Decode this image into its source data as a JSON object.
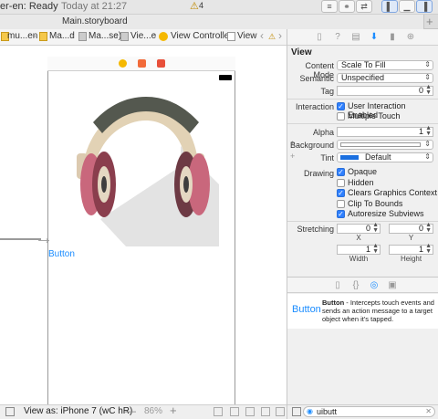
{
  "titlebar": {
    "status_prefix": "er-en:",
    "status_state": "Ready",
    "time": "Today at 21:27",
    "warning_count": "4"
  },
  "tab": {
    "title": "Main.storyboard"
  },
  "jumpbar": {
    "crumbs": [
      "mu...en",
      "Ma...d",
      "Ma...se)",
      "Vie...e",
      "View Controller",
      "View"
    ]
  },
  "canvas": {
    "button_label": "Button"
  },
  "bottombar": {
    "view_as": "View as: iPhone 7 (wC hR)",
    "zoom": "86%",
    "minus": "—",
    "plus": "+"
  },
  "inspector": {
    "section": "View",
    "content_mode_label": "Content Mode",
    "content_mode_value": "Scale To Fill",
    "semantic_label": "Semantic",
    "semantic_value": "Unspecified",
    "tag_label": "Tag",
    "tag_value": "0",
    "interaction_label": "Interaction",
    "user_interaction": "User Interaction Enabled",
    "multiple_touch": "Multiple Touch",
    "alpha_label": "Alpha",
    "alpha_value": "1",
    "background_label": "Background",
    "tint_label": "Tint",
    "tint_value": "Default",
    "drawing_label": "Drawing",
    "opaque": "Opaque",
    "hidden": "Hidden",
    "clears_context": "Clears Graphics Context",
    "clip_bounds": "Clip To Bounds",
    "autoresize": "Autoresize Subviews",
    "stretching_label": "Stretching",
    "stretch_x": "0",
    "stretch_y": "0",
    "x_label": "X",
    "y_label": "Y",
    "stretch_w": "1",
    "stretch_h": "1",
    "width_label": "Width",
    "height_label": "Height"
  },
  "library": {
    "item_label": "Button",
    "item_title": "Button",
    "item_desc": " - Intercepts touch events and sends an action message to a target object when it's tapped.",
    "filter_value": "uibutt"
  }
}
